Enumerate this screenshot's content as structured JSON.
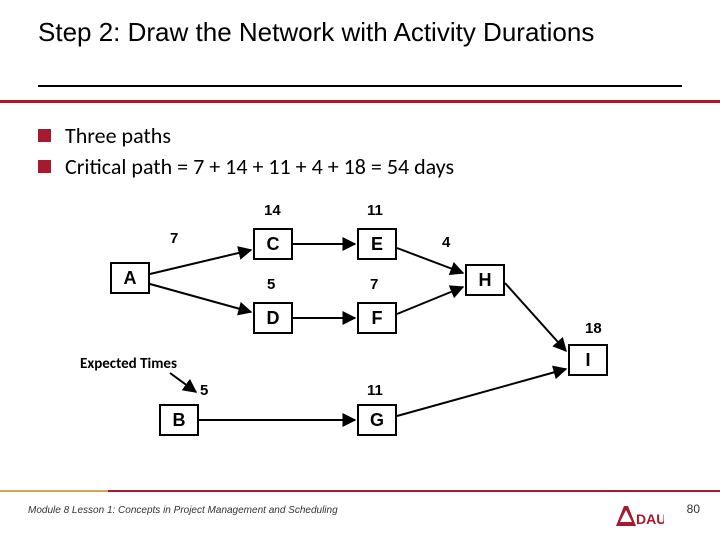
{
  "title": "Step 2: Draw the Network with Activity Durations",
  "bullets": [
    "Three paths",
    "Critical path = 7 + 14 + 11 + 4 + 18  = 54 days"
  ],
  "nodes": {
    "A": "A",
    "B": "B",
    "C": "C",
    "D": "D",
    "E": "E",
    "F": "F",
    "G": "G",
    "H": "H",
    "I": "I"
  },
  "durations": {
    "A": "7",
    "B": "5",
    "C": "14",
    "D": "5",
    "E": "11",
    "F": "7",
    "G": "11",
    "H": "4",
    "I": "18"
  },
  "label_expected": "Expected Times",
  "footer": "Module 8 Lesson 1: Concepts in Project Management and Scheduling",
  "page": "80",
  "logo_text": "DAU"
}
